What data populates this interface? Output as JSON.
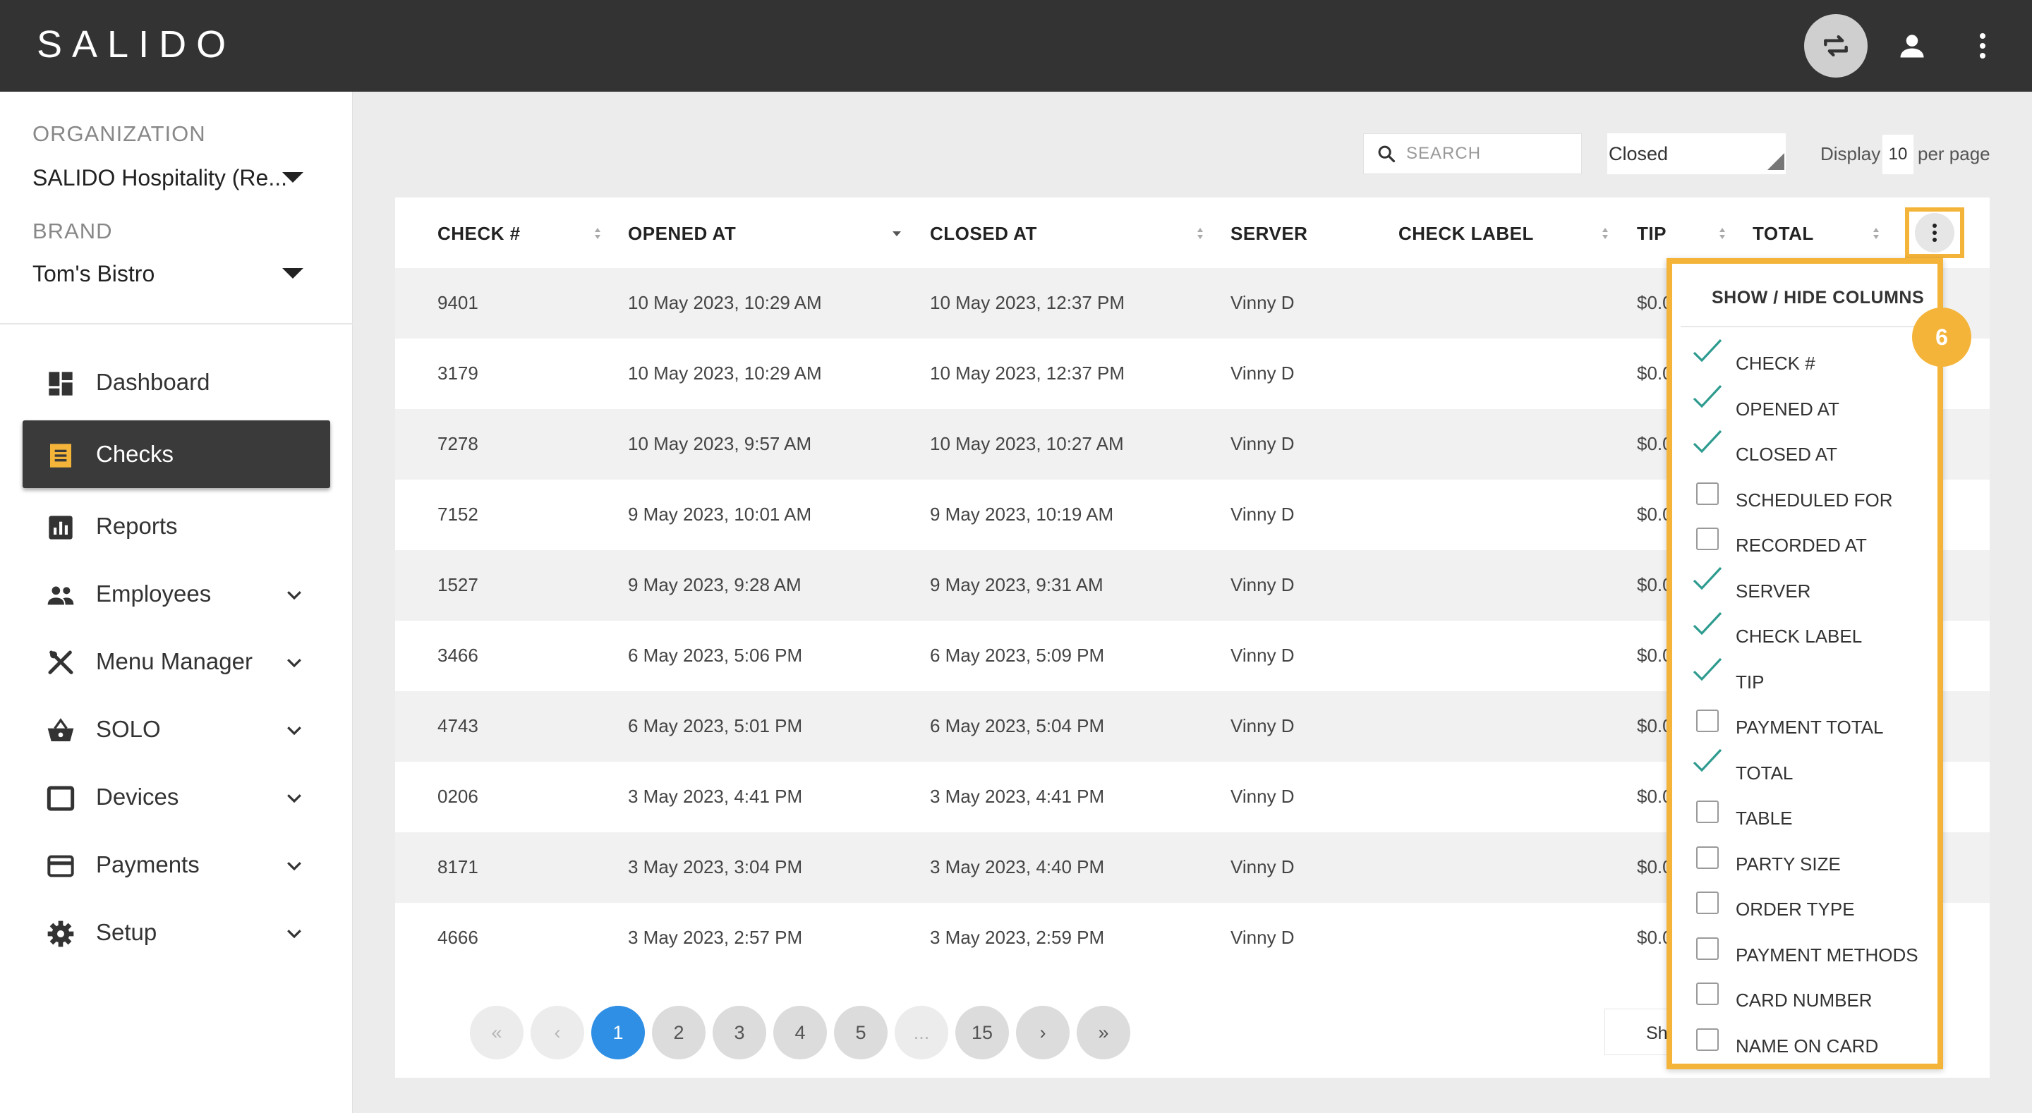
{
  "app": {
    "logo_text": "SALIDO"
  },
  "header": {
    "sync_icon": "sync-icon",
    "user_icon": "account-icon",
    "menu_icon": "kebab-menu-icon"
  },
  "sidebar": {
    "organization_label": "ORGANIZATION",
    "organization_value": "SALIDO Hospitality (Re...",
    "brand_label": "BRAND",
    "brand_value": "Tom's Bistro",
    "items": [
      {
        "label": "Dashboard",
        "icon": "dashboard-icon",
        "expandable": false,
        "active": false
      },
      {
        "label": "Checks",
        "icon": "receipt-icon",
        "expandable": false,
        "active": true
      },
      {
        "label": "Reports",
        "icon": "bar-chart-icon",
        "expandable": false,
        "active": false
      },
      {
        "label": "Employees",
        "icon": "people-icon",
        "expandable": true,
        "active": false
      },
      {
        "label": "Menu Manager",
        "icon": "utensils-icon",
        "expandable": true,
        "active": false
      },
      {
        "label": "SOLO",
        "icon": "basket-icon",
        "expandable": true,
        "active": false
      },
      {
        "label": "Devices",
        "icon": "device-icon",
        "expandable": true,
        "active": false
      },
      {
        "label": "Payments",
        "icon": "card-icon",
        "expandable": true,
        "active": false
      },
      {
        "label": "Setup",
        "icon": "gear-icon",
        "expandable": true,
        "active": false
      }
    ]
  },
  "filters": {
    "search_placeholder": "SEARCH",
    "status_value": "Closed",
    "display_label": "Display",
    "display_value": "10",
    "per_page_label": "per page"
  },
  "table": {
    "columns": [
      "CHECK #",
      "OPENED AT",
      "CLOSED AT",
      "SERVER",
      "CHECK LABEL",
      "TIP",
      "TOTAL"
    ],
    "rows": [
      {
        "check": "9401",
        "opened": "10 May 2023, 10:29 AM",
        "closed": "10 May 2023, 12:37 PM",
        "server": "Vinny D",
        "label": "",
        "tip": "$0.0"
      },
      {
        "check": "3179",
        "opened": "10 May 2023, 10:29 AM",
        "closed": "10 May 2023, 12:37 PM",
        "server": "Vinny D",
        "label": "",
        "tip": "$0.0"
      },
      {
        "check": "7278",
        "opened": "10 May 2023, 9:57 AM",
        "closed": "10 May 2023, 10:27 AM",
        "server": "Vinny D",
        "label": "",
        "tip": "$0.0"
      },
      {
        "check": "7152",
        "opened": "9 May 2023, 10:01 AM",
        "closed": "9 May 2023, 10:19 AM",
        "server": "Vinny D",
        "label": "",
        "tip": "$0.0"
      },
      {
        "check": "1527",
        "opened": "9 May 2023, 9:28 AM",
        "closed": "9 May 2023, 9:31 AM",
        "server": "Vinny D",
        "label": "",
        "tip": "$0.0"
      },
      {
        "check": "3466",
        "opened": "6 May 2023, 5:06 PM",
        "closed": "6 May 2023, 5:09 PM",
        "server": "Vinny D",
        "label": "",
        "tip": "$0.0"
      },
      {
        "check": "4743",
        "opened": "6 May 2023, 5:01 PM",
        "closed": "6 May 2023, 5:04 PM",
        "server": "Vinny D",
        "label": "",
        "tip": "$0.0"
      },
      {
        "check": "0206",
        "opened": "3 May 2023, 4:41 PM",
        "closed": "3 May 2023, 4:41 PM",
        "server": "Vinny D",
        "label": "",
        "tip": "$0.0"
      },
      {
        "check": "8171",
        "opened": "3 May 2023, 3:04 PM",
        "closed": "3 May 2023, 4:40 PM",
        "server": "Vinny D",
        "label": "",
        "tip": "$0.0"
      },
      {
        "check": "4666",
        "opened": "3 May 2023, 2:57 PM",
        "closed": "3 May 2023, 2:59 PM",
        "server": "Vinny D",
        "label": "",
        "tip": "$0.0"
      }
    ]
  },
  "pagination": {
    "first": "«",
    "prev": "‹",
    "pages": [
      "1",
      "2",
      "3",
      "4",
      "5",
      "...",
      "15"
    ],
    "active_page": "1",
    "next": "›",
    "last": "»",
    "show_button_label": "Sh"
  },
  "column_menu": {
    "title": "SHOW / HIDE COLUMNS",
    "badge": "6",
    "options": [
      {
        "label": "CHECK #",
        "checked": true
      },
      {
        "label": "OPENED AT",
        "checked": true
      },
      {
        "label": "CLOSED AT",
        "checked": true
      },
      {
        "label": "SCHEDULED FOR",
        "checked": false
      },
      {
        "label": "RECORDED AT",
        "checked": false
      },
      {
        "label": "SERVER",
        "checked": true
      },
      {
        "label": "CHECK LABEL",
        "checked": true
      },
      {
        "label": "TIP",
        "checked": true
      },
      {
        "label": "PAYMENT TOTAL",
        "checked": false
      },
      {
        "label": "TOTAL",
        "checked": true
      },
      {
        "label": "TABLE",
        "checked": false
      },
      {
        "label": "PARTY SIZE",
        "checked": false
      },
      {
        "label": "ORDER TYPE",
        "checked": false
      },
      {
        "label": "PAYMENT METHODS",
        "checked": false
      },
      {
        "label": "CARD NUMBER",
        "checked": false
      },
      {
        "label": "NAME ON CARD",
        "checked": false
      }
    ]
  },
  "colors": {
    "accent_blue": "#2f8fe5",
    "highlight_orange": "#f4b43a",
    "check_teal": "#2e9b8f",
    "topbar": "#333333"
  }
}
